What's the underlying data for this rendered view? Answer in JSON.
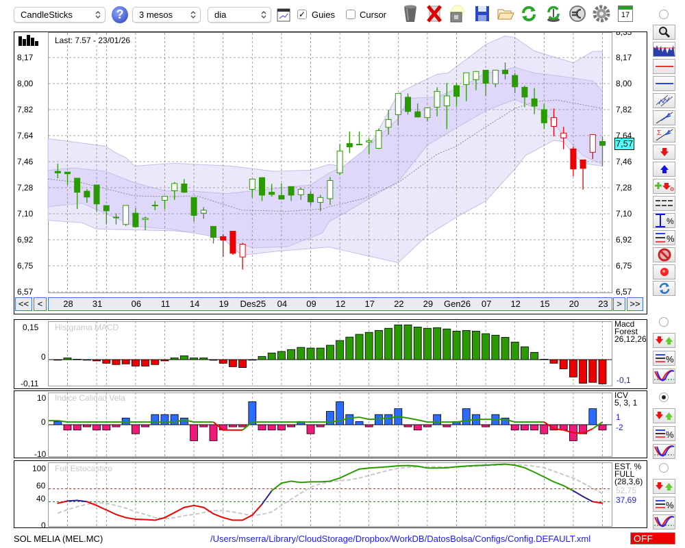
{
  "toolbar": {
    "chart_type": "CandleSticks",
    "help": "?",
    "period": "3 mesos",
    "interval": "dia",
    "guides_label": "Guies",
    "guides_checked": true,
    "cursor_label": "Cursor",
    "cursor_checked": false,
    "calendar_day": "17",
    "check_mark": "✓"
  },
  "main": {
    "last_label": "Last: 7.57 - 23/01/26",
    "price_tag": "7,57",
    "y_labels": [
      "8,35",
      "8,17",
      "8,00",
      "7,82",
      "7,64",
      "7,46",
      "7,28",
      "7,10",
      "6,92",
      "6,75",
      "6,57"
    ],
    "nav": {
      "first": "<<",
      "prev": "<",
      "next": ">",
      "last": ">>"
    },
    "date_labels": [
      {
        "label": "28",
        "index": 1
      },
      {
        "label": "31",
        "index": 4
      },
      {
        "label": "06",
        "index": 8
      },
      {
        "label": "11",
        "index": 11
      },
      {
        "label": "14",
        "index": 14
      },
      {
        "label": "19",
        "index": 17
      },
      {
        "label": "Des25",
        "index": 20
      },
      {
        "label": "04",
        "index": 23
      },
      {
        "label": "09",
        "index": 26
      },
      {
        "label": "12",
        "index": 29
      },
      {
        "label": "17",
        "index": 32
      },
      {
        "label": "22",
        "index": 35
      },
      {
        "label": "29",
        "index": 38
      },
      {
        "label": "Gen26",
        "index": 41
      },
      {
        "label": "07",
        "index": 44
      },
      {
        "label": "12",
        "index": 47
      },
      {
        "label": "15",
        "index": 50
      },
      {
        "label": "20",
        "index": 53
      },
      {
        "label": "23",
        "index": 56
      }
    ],
    "extra_grid_index": [
      5
    ]
  },
  "panels": {
    "macd": {
      "title": "Histgrama MACD",
      "y_labels": [
        "0,15",
        "0",
        "-0,11"
      ],
      "info": [
        "Macd",
        "Forest",
        "26,12,26"
      ],
      "last": "-0,1"
    },
    "icv": {
      "title": "Indice Calidad Vela",
      "y_labels": [
        "10",
        "0",
        "-10"
      ],
      "info": [
        "ICV",
        "5, 3, 1"
      ],
      "last_1": "1",
      "last_2": "-2"
    },
    "stoch": {
      "title": "Full Estocastico",
      "y_labels": [
        "100",
        "60",
        "40",
        "0"
      ],
      "info": [
        "EST. %",
        "FULL",
        "(28,3,6)"
      ],
      "last_d": "52,75",
      "last_k": "37,69"
    }
  },
  "footer": {
    "symbol": "SOL MELIA (MEL.MC)",
    "config_path": "/Users/mserra/Library/CloudStorage/Dropbox/WorkDB/DatosBolsa/Configs/Config.DEFAULT.xml",
    "status": "OFF"
  },
  "colors": {
    "up": "#2a9a00",
    "down": "#ee0000",
    "band_outer": "#ece8fc",
    "band_inner": "#e0d8fa",
    "band_stroke": "#c4bce6",
    "macd_pos": "#2a9a00",
    "macd_neg": "#ee0000",
    "icv_pos": "#2b6bff",
    "icv_neg": "#f0187a",
    "stoch_high": "#2a9a00",
    "stoch_mid": "#2a1f8f",
    "stoch_low": "#ee0000",
    "price_tag": "#55ffff"
  },
  "chart_data": {
    "type": "candlestick",
    "price_range": [
      6.57,
      8.35
    ],
    "candles_ohlc_style": [
      [
        7.393,
        7.445,
        7.346,
        7.382,
        "F"
      ],
      [
        7.388,
        7.388,
        7.3,
        7.376,
        "F"
      ],
      [
        7.346,
        7.346,
        7.136,
        7.25,
        "F"
      ],
      [
        7.257,
        7.271,
        7.178,
        7.217,
        "F"
      ],
      [
        7.3,
        7.3,
        7.115,
        7.17,
        "F"
      ],
      [
        7.159,
        7.159,
        7.03,
        7.123,
        "F"
      ],
      [
        7.08,
        7.105,
        7.03,
        7.08,
        "F"
      ],
      [
        7.03,
        7.16,
        7.02,
        7.16,
        "H"
      ],
      [
        7.107,
        7.143,
        7.01,
        7.014,
        "F"
      ],
      [
        7.064,
        7.084,
        6.99,
        7.073,
        "H"
      ],
      [
        7.162,
        7.19,
        7.128,
        7.162,
        "F"
      ],
      [
        7.195,
        7.222,
        7.133,
        7.222,
        "H"
      ],
      [
        7.26,
        7.32,
        7.198,
        7.31,
        "H"
      ],
      [
        7.307,
        7.34,
        7.245,
        7.25,
        "F"
      ],
      [
        7.214,
        7.214,
        7.05,
        7.092,
        "F"
      ],
      [
        7.107,
        7.148,
        7.069,
        7.127,
        "H"
      ],
      [
        7.017,
        7.017,
        6.9,
        6.942,
        "F"
      ],
      [
        6.947,
        6.964,
        6.808,
        6.923,
        "R"
      ],
      [
        6.984,
        6.984,
        6.823,
        6.833,
        "R"
      ],
      [
        6.808,
        6.905,
        6.722,
        6.895,
        "r"
      ],
      [
        7.27,
        7.34,
        7.213,
        7.34,
        "H"
      ],
      [
        7.35,
        7.35,
        7.19,
        7.23,
        "F"
      ],
      [
        7.25,
        7.307,
        7.22,
        7.235,
        "F"
      ],
      [
        7.228,
        7.31,
        7.203,
        7.203,
        "F"
      ],
      [
        7.289,
        7.289,
        7.19,
        7.23,
        "F"
      ],
      [
        7.233,
        7.279,
        7.198,
        7.27,
        "H"
      ],
      [
        7.237,
        7.257,
        7.16,
        7.184,
        "F"
      ],
      [
        7.181,
        7.232,
        7.12,
        7.214,
        "H"
      ],
      [
        7.206,
        7.354,
        7.164,
        7.33,
        "H"
      ],
      [
        7.382,
        7.58,
        7.367,
        7.532,
        "H"
      ],
      [
        7.583,
        7.665,
        7.518,
        7.56,
        "F"
      ],
      [
        7.578,
        7.665,
        7.578,
        7.578,
        "F"
      ],
      [
        7.593,
        7.62,
        7.508,
        7.602,
        "H"
      ],
      [
        7.55,
        7.685,
        7.546,
        7.672,
        "H"
      ],
      [
        7.693,
        7.814,
        7.643,
        7.747,
        "H"
      ],
      [
        7.78,
        7.925,
        7.705,
        7.925,
        "H"
      ],
      [
        7.899,
        7.925,
        7.78,
        7.802,
        "F"
      ],
      [
        7.8,
        7.856,
        7.76,
        7.764,
        "F"
      ],
      [
        7.76,
        7.827,
        7.733,
        7.827,
        "H"
      ],
      [
        7.831,
        7.967,
        7.768,
        7.939,
        "H"
      ],
      [
        7.84,
        7.997,
        7.68,
        7.908,
        "H"
      ],
      [
        7.978,
        7.994,
        7.835,
        7.905,
        "F"
      ],
      [
        7.986,
        8.066,
        7.872,
        8.066,
        "H"
      ],
      [
        8.019,
        8.075,
        7.947,
        8.075,
        "H"
      ],
      [
        8.084,
        8.084,
        7.908,
        7.994,
        "F"
      ],
      [
        7.991,
        8.084,
        7.967,
        8.084,
        "H"
      ],
      [
        8.084,
        8.137,
        8.02,
        8.059,
        "F"
      ],
      [
        8.048,
        8.064,
        7.928,
        7.97,
        "F"
      ],
      [
        7.967,
        7.978,
        7.83,
        7.9,
        "F"
      ],
      [
        7.888,
        7.962,
        7.783,
        7.838,
        "F"
      ],
      [
        7.814,
        7.853,
        7.682,
        7.724,
        "F"
      ],
      [
        7.7,
        7.822,
        7.632,
        7.76,
        "r"
      ],
      [
        7.621,
        7.696,
        7.544,
        7.654,
        "r"
      ],
      [
        7.546,
        7.562,
        7.359,
        7.409,
        "R"
      ],
      [
        7.471,
        7.471,
        7.268,
        7.413,
        "R"
      ],
      [
        7.523,
        7.644,
        7.477,
        7.644,
        "r"
      ],
      [
        7.597,
        7.63,
        7.427,
        7.57,
        "F"
      ]
    ],
    "bands": {
      "outer_upper": [
        [
          -1,
          7.616
        ],
        [
          4.9,
          7.565
        ],
        [
          6,
          7.518
        ],
        [
          7,
          7.487
        ],
        [
          7.9,
          7.429
        ],
        [
          11.9,
          7.448
        ],
        [
          17.8,
          7.429
        ],
        [
          22.2,
          7.393
        ],
        [
          26,
          7.401
        ],
        [
          27.9,
          7.44
        ],
        [
          30,
          7.42
        ],
        [
          32.6,
          7.627
        ],
        [
          35,
          7.924
        ],
        [
          36.1,
          7.963
        ],
        [
          39,
          8.056
        ],
        [
          40.1,
          8.064
        ],
        [
          42,
          8.157
        ],
        [
          44,
          8.259
        ],
        [
          46,
          8.317
        ],
        [
          47,
          8.306
        ],
        [
          49,
          8.215
        ],
        [
          53,
          8.134
        ],
        [
          55,
          8.212
        ],
        [
          56,
          8.212
        ]
      ],
      "inner_upper": [
        [
          -1,
          7.4
        ],
        [
          1.6,
          7.416
        ],
        [
          4.9,
          7.393
        ],
        [
          7.9,
          7.315
        ],
        [
          11,
          7.26
        ],
        [
          14.3,
          7.256
        ],
        [
          17.3,
          7.24
        ],
        [
          20,
          7.26
        ],
        [
          26,
          7.3
        ],
        [
          27.9,
          7.38
        ],
        [
          29.3,
          7.424
        ],
        [
          31.4,
          7.533
        ],
        [
          35,
          7.752
        ],
        [
          36.1,
          7.892
        ],
        [
          39,
          7.9
        ],
        [
          42,
          7.986
        ],
        [
          44,
          8.064
        ],
        [
          46,
          8.087
        ],
        [
          47,
          8.103
        ],
        [
          49,
          8.064
        ],
        [
          52,
          8.04
        ],
        [
          55,
          8.01
        ],
        [
          56,
          7.94
        ]
      ],
      "middle": [
        [
          -1,
          7.34
        ],
        [
          2.5,
          7.315
        ],
        [
          7.9,
          7.225
        ],
        [
          11.9,
          7.22
        ],
        [
          14.3,
          7.225
        ],
        [
          18.9,
          7.128
        ],
        [
          23.6,
          7.12
        ],
        [
          27.2,
          7.136
        ],
        [
          27.9,
          7.151
        ],
        [
          31.4,
          7.206
        ],
        [
          35,
          7.315
        ],
        [
          39,
          7.51
        ],
        [
          41,
          7.565
        ],
        [
          44,
          7.697
        ],
        [
          47,
          7.822
        ],
        [
          49,
          7.869
        ],
        [
          51.3,
          7.88
        ],
        [
          56,
          7.822
        ]
      ],
      "inner_lower": [
        [
          -1,
          7.151
        ],
        [
          2.5,
          7.175
        ],
        [
          7.9,
          7.019
        ],
        [
          11.9,
          6.995
        ],
        [
          16.6,
          6.941
        ],
        [
          20.1,
          6.87
        ],
        [
          23.6,
          6.878
        ],
        [
          27.2,
          6.972
        ],
        [
          27.9,
          7.05
        ],
        [
          29.3,
          7.1
        ],
        [
          35,
          7.323
        ],
        [
          38,
          7.572
        ],
        [
          41,
          7.69
        ],
        [
          44,
          7.806
        ],
        [
          47,
          7.884
        ],
        [
          50,
          7.8
        ],
        [
          52,
          7.64
        ],
        [
          54,
          7.5
        ],
        [
          56,
          7.44
        ]
      ],
      "outer_lower": [
        [
          -1,
          7.058
        ],
        [
          2.5,
          7.042
        ],
        [
          3.9,
          7.0
        ],
        [
          6.3,
          6.995
        ],
        [
          11.9,
          6.987
        ],
        [
          16.6,
          6.956
        ],
        [
          18.9,
          6.82
        ],
        [
          22.5,
          6.847
        ],
        [
          27.9,
          6.875
        ],
        [
          35,
          6.769
        ],
        [
          38,
          6.956
        ],
        [
          41,
          7.081
        ],
        [
          44,
          7.19
        ],
        [
          47,
          7.409
        ],
        [
          48.1,
          7.502
        ],
        [
          51,
          7.604
        ],
        [
          52,
          7.596
        ],
        [
          53,
          7.51
        ],
        [
          54,
          7.448
        ],
        [
          56,
          7.428
        ]
      ]
    },
    "macd_histogram": [
      0,
      0.008,
      0.002,
      0,
      -0.006,
      -0.017,
      -0.023,
      -0.02,
      -0.03,
      -0.03,
      -0.023,
      -0.006,
      0.008,
      0.018,
      0.008,
      0.008,
      -0.003,
      -0.017,
      -0.033,
      -0.037,
      0,
      0.015,
      0.031,
      0.038,
      0.047,
      0.057,
      0.054,
      0.054,
      0.067,
      0.089,
      0.105,
      0.118,
      0.127,
      0.136,
      0.146,
      0.162,
      0.162,
      0.152,
      0.146,
      0.149,
      0.143,
      0.133,
      0.136,
      0.133,
      0.121,
      0.114,
      0.104,
      0.082,
      0.06,
      0.034,
      0.002,
      -0.017,
      -0.043,
      -0.081,
      -0.11,
      -0.106,
      -0.113
    ],
    "macd_range": [
      -0.11,
      0.15
    ],
    "icv_bars": [
      1.2,
      -2,
      -2,
      -0.8,
      -2,
      -2,
      -0.8,
      2.5,
      -3.4,
      -0.8,
      3.8,
      3.8,
      3.8,
      2.5,
      -6,
      -0.8,
      -6,
      -2,
      -0.8,
      -0.8,
      8.6,
      -2,
      -2,
      -2,
      -0.8,
      1.2,
      -3.4,
      -0.8,
      5,
      8.6,
      3.8,
      1.2,
      -0.8,
      3.8,
      3.8,
      6,
      -0.8,
      -2,
      -0.8,
      3.8,
      -0.8,
      1.2,
      6,
      3.8,
      -0.8,
      3.8,
      2.5,
      -2,
      -2,
      -2,
      -3.4,
      -2,
      -2,
      -6,
      -3.4,
      6,
      -2
    ],
    "icv_signal": [
      1.5,
      1,
      1,
      1,
      1,
      1,
      1,
      1,
      1,
      1,
      1,
      1,
      1,
      1.8,
      1,
      1,
      1,
      -2,
      -2,
      -2,
      1,
      1,
      1,
      1,
      1,
      1,
      1,
      1,
      1,
      1.5,
      2.5,
      2.8,
      2,
      2.2,
      2.5,
      3,
      2.5,
      1.8,
      1,
      1,
      1,
      1,
      1.5,
      2,
      2,
      2,
      2,
      1,
      1,
      1,
      1,
      -1.5,
      -2,
      -3,
      -3.2,
      -1.5,
      1
    ],
    "icv_range": [
      -10,
      10
    ],
    "stoch_k": [
      37.5,
      41,
      42,
      40,
      34,
      27,
      20,
      15,
      12.5,
      12,
      11,
      15,
      23,
      31,
      34,
      31,
      21,
      15,
      11,
      11,
      19,
      36,
      57,
      69,
      72,
      70,
      71,
      71,
      72,
      77,
      84,
      91,
      92.5,
      93.5,
      94.6,
      96,
      96.4,
      95.4,
      92.5,
      92.5,
      93,
      94.6,
      95.7,
      96.4,
      97,
      97.9,
      98.6,
      97,
      93,
      86,
      78.6,
      71,
      65,
      57,
      48,
      40,
      37.69
    ],
    "stoch_d": [
      22,
      27.5,
      32,
      36,
      38,
      37.5,
      34,
      30,
      24,
      20,
      15,
      13.5,
      15,
      18,
      20,
      23,
      26,
      26,
      24,
      21,
      18.5,
      20,
      24,
      34,
      44,
      53.5,
      62.5,
      68,
      71,
      73,
      74,
      77,
      81,
      85,
      89,
      92,
      93.6,
      94.6,
      94.6,
      94.6,
      94,
      94,
      94.6,
      95.4,
      96.4,
      97,
      98,
      98,
      97,
      95.4,
      93,
      87.5,
      82,
      77,
      69,
      61,
      52.75
    ],
    "stoch_levels": [
      60,
      40
    ],
    "stoch_range": [
      0,
      100
    ]
  }
}
